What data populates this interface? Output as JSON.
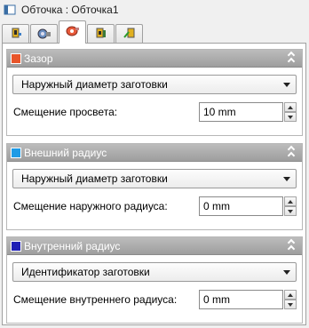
{
  "window": {
    "title": "Обточка : Обточка1",
    "icon": "toolpath-icon"
  },
  "tabs": [
    {
      "icon": "tool-holder-icon",
      "active": false
    },
    {
      "icon": "cutter-icon",
      "active": false
    },
    {
      "icon": "turning-profile-icon",
      "active": true
    },
    {
      "icon": "feed-params-icon",
      "active": false
    },
    {
      "icon": "linking-icon",
      "active": false
    }
  ],
  "groups": [
    {
      "title": "Зазор",
      "color": "#e8552a",
      "dropdown_value": "Наружный диаметр заготовки",
      "field_label": "Смещение просвета:",
      "field_value": "10 mm"
    },
    {
      "title": "Внешний радиус",
      "color": "#1e9be6",
      "dropdown_value": "Наружный диаметр заготовки",
      "field_label": "Смещение наружного радиуса:",
      "field_value": "0 mm"
    },
    {
      "title": "Внутренний радиус",
      "color": "#1f1fb5",
      "dropdown_value": "Идентификатор заготовки",
      "field_label": "Смещение внутреннего радиуса:",
      "field_value": "0 mm"
    }
  ]
}
